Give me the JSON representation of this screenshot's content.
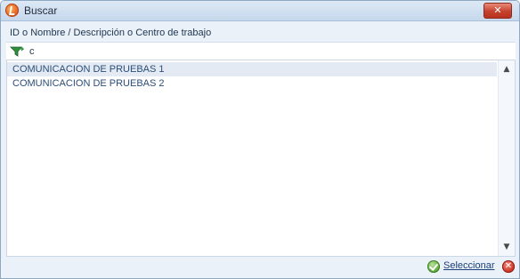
{
  "window": {
    "title": "Buscar",
    "close_glyph": "✕"
  },
  "search": {
    "label": "ID o Nombre / Descripción o Centro de trabajo",
    "value": "c",
    "filter_icon": "filter-icon"
  },
  "results": {
    "items": [
      {
        "label": "COMUNICACION DE PRUEBAS 1",
        "selected": true
      },
      {
        "label": "COMUNICACION DE PRUEBAS 2",
        "selected": false
      }
    ]
  },
  "scrollbar": {
    "up_glyph": "▲",
    "down_glyph": "▼"
  },
  "footer": {
    "select_label": "Seleccionar",
    "select_icon": "check-circle-icon",
    "cancel_icon": "cancel-circle-icon",
    "cancel_glyph": "✕"
  },
  "colors": {
    "accent": "#2b4d78",
    "selection": "#e3eaf3",
    "close": "#c4422e"
  }
}
